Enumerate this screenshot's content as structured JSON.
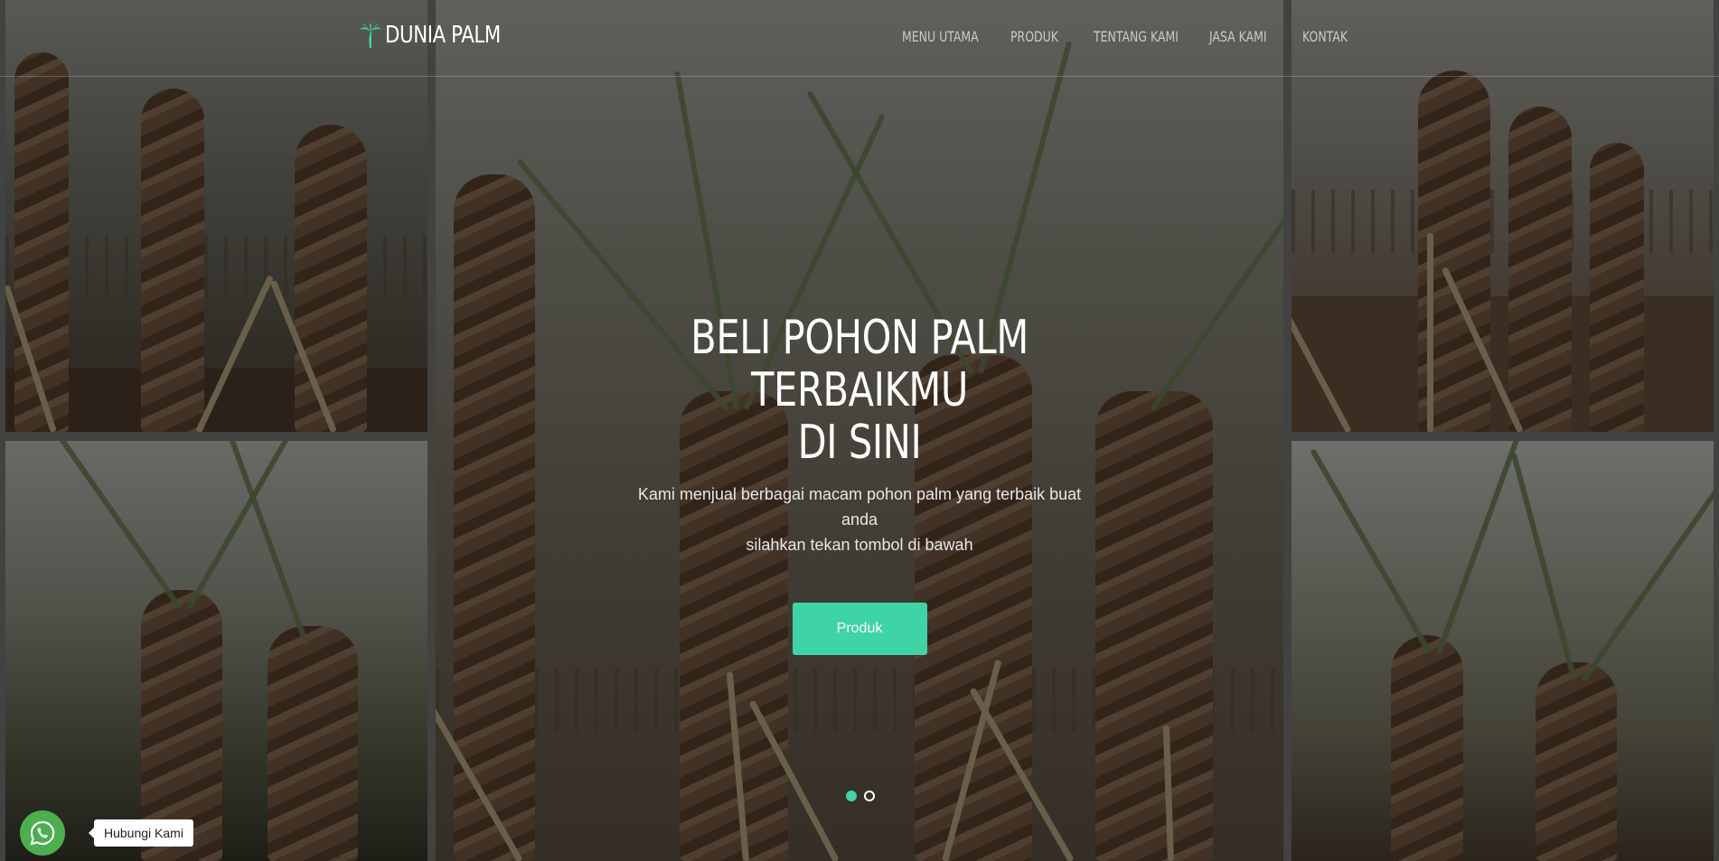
{
  "brand": {
    "name": "DUNIA PALM",
    "icon": "palm-tree-icon",
    "icon_color": "#3fd4a6"
  },
  "nav": {
    "items": [
      {
        "label": "MENU UTAMA"
      },
      {
        "label": "PRODUK"
      },
      {
        "label": "TENTANG KAMI"
      },
      {
        "label": "JASA KAMI"
      },
      {
        "label": "KONTAK"
      }
    ]
  },
  "hero": {
    "title_line1": "BELI POHON PALM TERBAIKMU",
    "title_line2": "DI SINI",
    "subtitle_line1": "Kami menjual berbagai macam pohon palm yang terbaik buat anda",
    "subtitle_line2": "silahkan tekan tombol di bawah",
    "cta_label": "Produk"
  },
  "carousel": {
    "slide_count": 2,
    "active_index": 0
  },
  "whatsapp": {
    "label": "Hubungi Kami",
    "icon": "whatsapp-icon",
    "color": "#4cae4f"
  },
  "colors": {
    "accent": "#3fd4a6",
    "overlay": "rgba(0,0,0,0.52)"
  }
}
